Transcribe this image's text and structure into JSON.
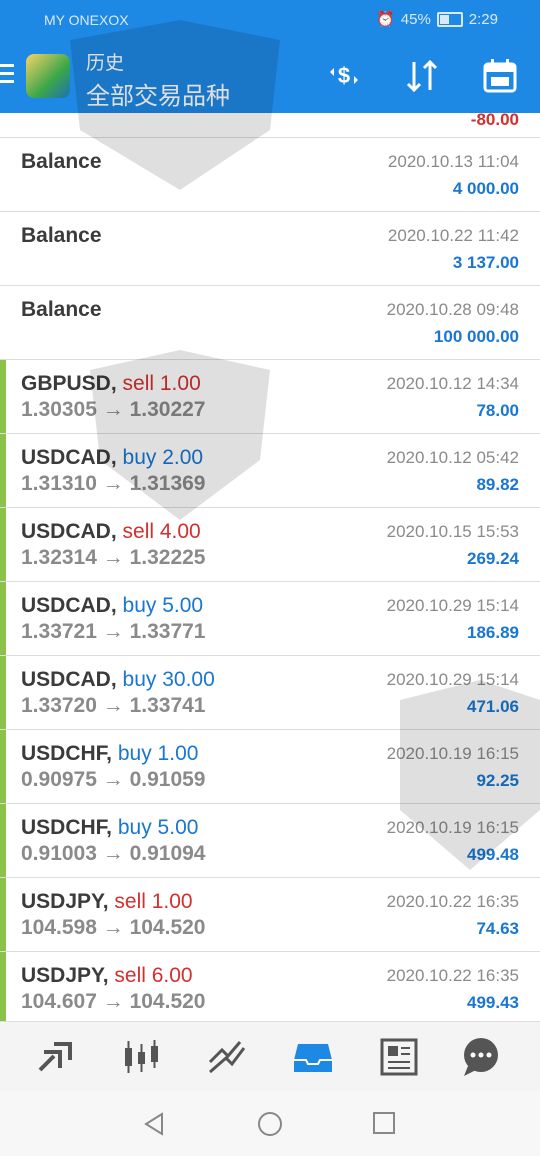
{
  "status_bar": {
    "carrier": "MY ONEXOX",
    "battery": "45%",
    "time": "2:29"
  },
  "app_bar": {
    "title": "历史",
    "subtitle": "全部交易品种"
  },
  "partial_row": {
    "amount": "-80.00"
  },
  "balances": [
    {
      "label": "Balance",
      "datetime": "2020.10.13 11:04",
      "amount": "4 000.00"
    },
    {
      "label": "Balance",
      "datetime": "2020.10.22 11:42",
      "amount": "3 137.00"
    },
    {
      "label": "Balance",
      "datetime": "2020.10.28 09:48",
      "amount": "100 000.00"
    }
  ],
  "trades": [
    {
      "symbol": "GBPUSD,",
      "side": "sell 1.00",
      "prices": "1.30305 → 1.30227",
      "datetime": "2020.10.12 14:34",
      "profit": "78.00"
    },
    {
      "symbol": "USDCAD,",
      "side": "buy 2.00",
      "prices": "1.31310 → 1.31369",
      "datetime": "2020.10.12 05:42",
      "profit": "89.82"
    },
    {
      "symbol": "USDCAD,",
      "side": "sell 4.00",
      "prices": "1.32314 → 1.32225",
      "datetime": "2020.10.15 15:53",
      "profit": "269.24"
    },
    {
      "symbol": "USDCAD,",
      "side": "buy 5.00",
      "prices": "1.33721 → 1.33771",
      "datetime": "2020.10.29 15:14",
      "profit": "186.89"
    },
    {
      "symbol": "USDCAD,",
      "side": "buy 30.00",
      "prices": "1.33720 → 1.33741",
      "datetime": "2020.10.29 15:14",
      "profit": "471.06"
    },
    {
      "symbol": "USDCHF,",
      "side": "buy 1.00",
      "prices": "0.90975 → 0.91059",
      "datetime": "2020.10.19 16:15",
      "profit": "92.25"
    },
    {
      "symbol": "USDCHF,",
      "side": "buy 5.00",
      "prices": "0.91003 → 0.91094",
      "datetime": "2020.10.19 16:15",
      "profit": "499.48"
    },
    {
      "symbol": "USDJPY,",
      "side": "sell 1.00",
      "prices": "104.598 → 104.520",
      "datetime": "2020.10.22 16:35",
      "profit": "74.63"
    },
    {
      "symbol": "USDJPY,",
      "side": "sell 6.00",
      "prices": "104.607 → 104.520",
      "datetime": "2020.10.22 16:35",
      "profit": "499.43"
    }
  ],
  "colors": {
    "primary": "#1e88e5",
    "buy": "#1976d2",
    "sell": "#d32f2f",
    "trade_marker": "#8bc34a"
  },
  "icons": {
    "app_bar": [
      "dollar-exchange-icon",
      "sort-icon",
      "calendar-icon"
    ],
    "bottom_nav": [
      "quotes-icon",
      "chart-icon",
      "trade-icon",
      "history-icon",
      "news-icon",
      "chat-icon"
    ],
    "system_nav": [
      "back-icon",
      "home-icon",
      "recents-icon"
    ]
  }
}
